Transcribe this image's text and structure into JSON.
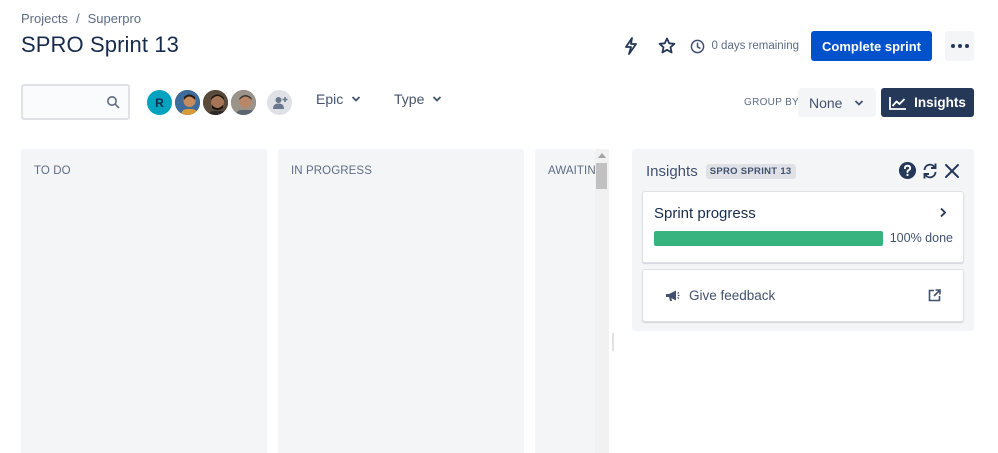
{
  "breadcrumb": {
    "root": "Projects",
    "separator": "/",
    "project": "Superpro"
  },
  "page": {
    "title": "SPRO Sprint 13"
  },
  "header": {
    "days_remaining": "0 days remaining",
    "complete_sprint_label": "Complete sprint",
    "icons": [
      "lightning-icon",
      "star-icon",
      "clock-icon",
      "more-icon"
    ]
  },
  "filters": {
    "search_placeholder": "",
    "avatars": [
      {
        "initial": "R",
        "color": "#00a3bf"
      },
      {
        "initial": "",
        "color": "#7a5c3e"
      },
      {
        "initial": "",
        "color": "#4a3b2f"
      },
      {
        "initial": "",
        "color": "#8a8076"
      }
    ],
    "epic_label": "Epic",
    "type_label": "Type",
    "group_by_label": "GROUP BY",
    "group_by_value": "None",
    "insights_label": "Insights"
  },
  "columns": [
    {
      "title": "TO DO"
    },
    {
      "title": "IN PROGRESS"
    },
    {
      "title": "AWAITIN"
    }
  ],
  "insights_panel": {
    "title": "Insights",
    "sprint_badge": "SPRO SPRINT 13",
    "sprint_progress": {
      "title": "Sprint progress",
      "done_percent": 100,
      "done_label": "100% done"
    },
    "feedback_label": "Give feedback"
  },
  "colors": {
    "primary": "#0052cc",
    "insights_button": "#253858",
    "progress": "#36b37e"
  }
}
